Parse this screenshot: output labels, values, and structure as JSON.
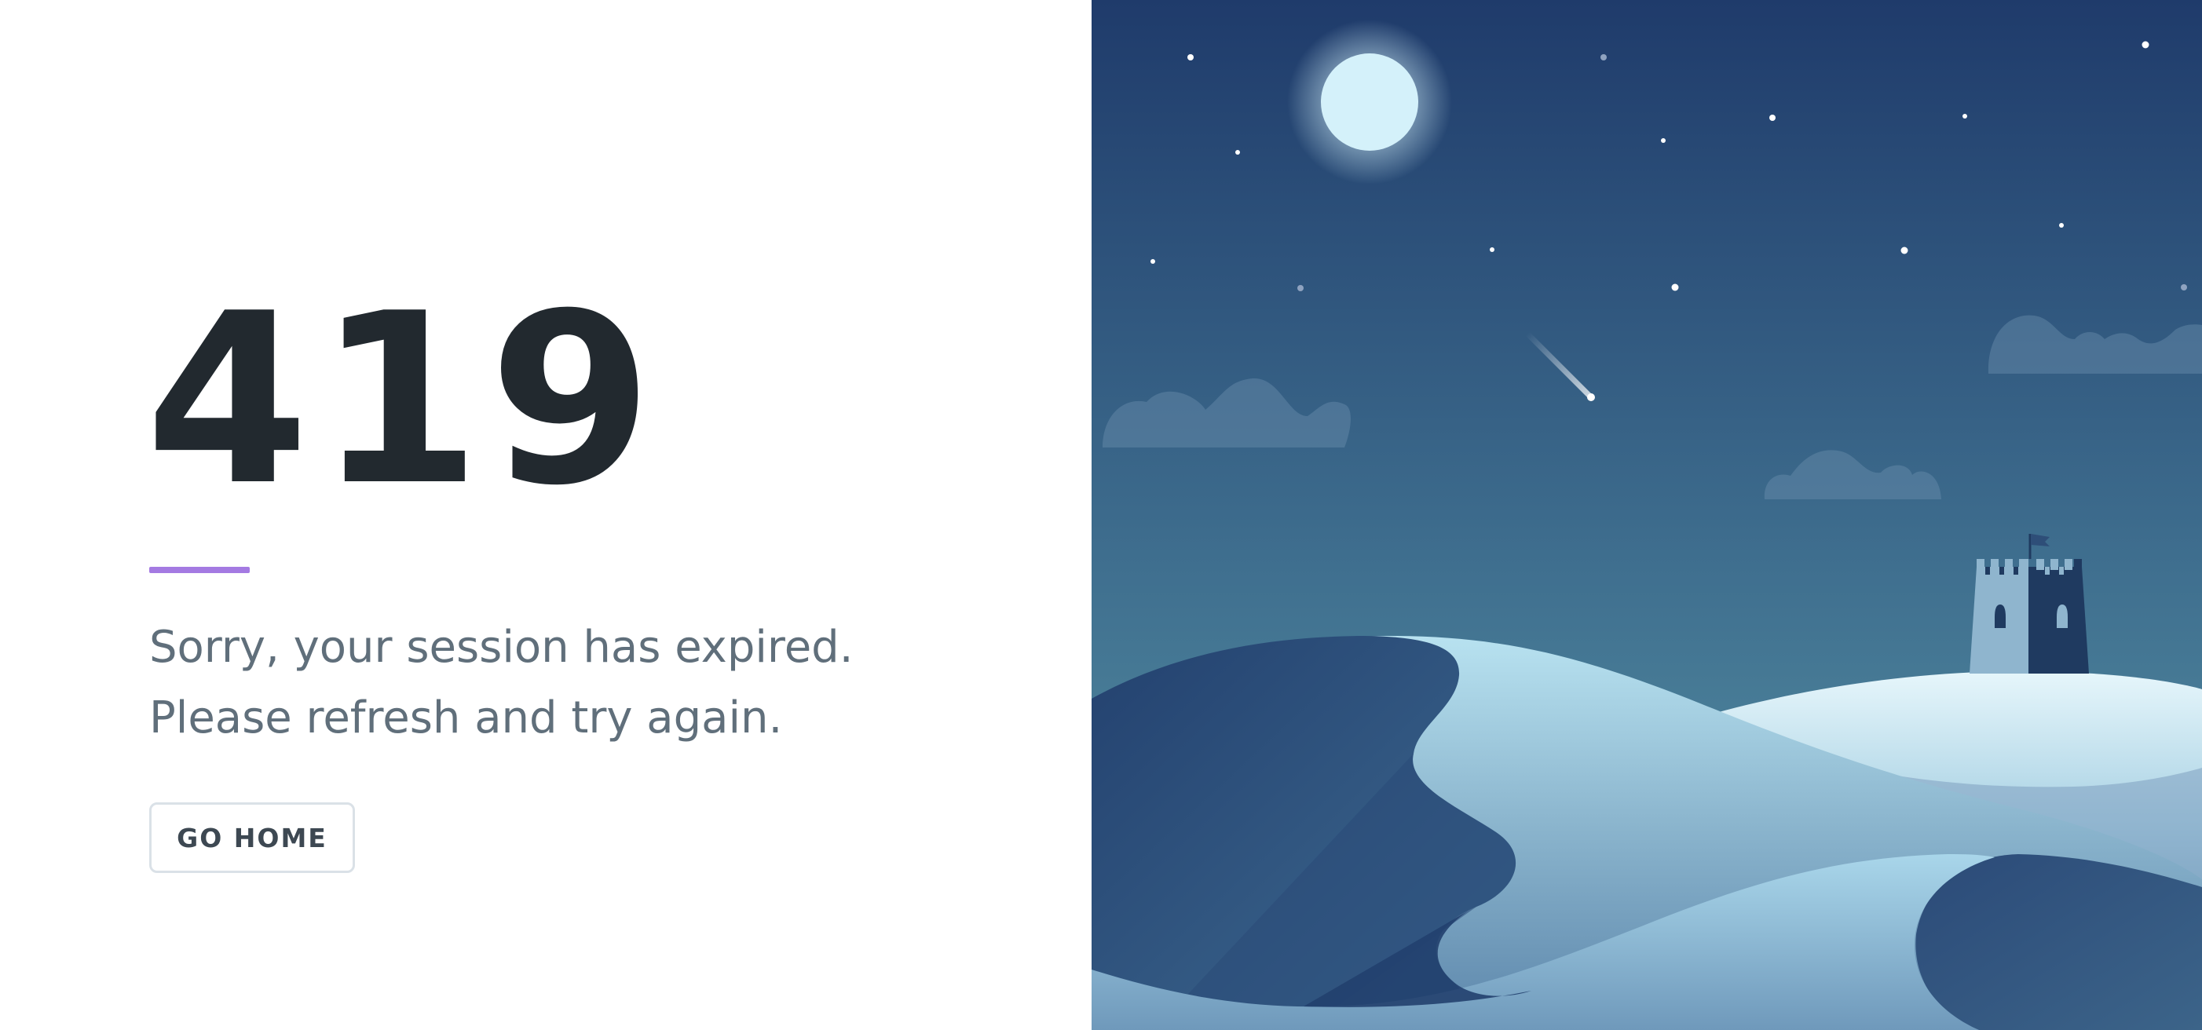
{
  "error": {
    "code": "419",
    "message_line1": "Sorry, your session has expired.",
    "message_line2": "Please refresh and try again."
  },
  "actions": {
    "home_label": "GO HOME"
  },
  "colors": {
    "accent": "#a47ae2",
    "heading": "#22292f",
    "body_text": "#606f7b",
    "sky_top": "#1f3b6b",
    "sky_bottom": "#5a97a6",
    "moon": "#d4f1fa"
  },
  "illustration": {
    "icons": [
      "moon-icon",
      "star-icon",
      "shooting-star-icon",
      "cloud-icon",
      "castle-icon",
      "flag-icon",
      "dune-icon"
    ]
  }
}
